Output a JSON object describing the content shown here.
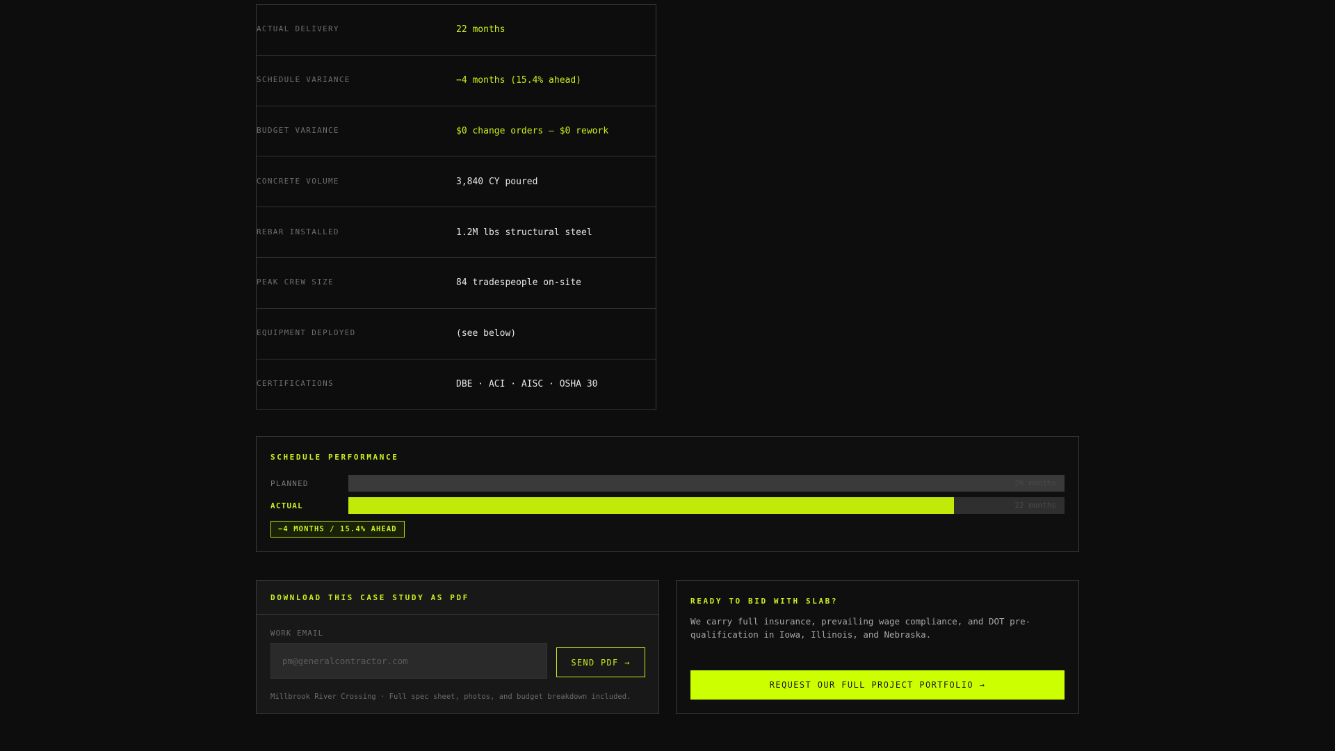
{
  "specs": [
    {
      "label": "ACTUAL DELIVERY",
      "value": "22 months",
      "accent": true
    },
    {
      "label": "SCHEDULE VARIANCE",
      "value": "−4 months (15.4% ahead)",
      "accent": true
    },
    {
      "label": "BUDGET VARIANCE",
      "value": "$0 change orders — $0 rework",
      "accent": true
    },
    {
      "label": "CONCRETE VOLUME",
      "value": "3,840 CY poured",
      "accent": false
    },
    {
      "label": "REBAR INSTALLED",
      "value": "1.2M lbs structural steel",
      "accent": false
    },
    {
      "label": "PEAK CREW SIZE",
      "value": "84 tradespeople on-site",
      "accent": false
    },
    {
      "label": "EQUIPMENT DEPLOYED",
      "value": "(see below)",
      "accent": false
    },
    {
      "label": "CERTIFICATIONS",
      "value": "DBE · ACI · AISC · OSHA 30",
      "accent": false
    }
  ],
  "schedule": {
    "title": "SCHEDULE PERFORMANCE",
    "planned_label": "PLANNED",
    "planned_value": "26 months",
    "planned_fraction": 1.0,
    "actual_label": "ACTUAL",
    "actual_value": "22 months",
    "actual_fraction": 0.846,
    "badge": "−4 MONTHS / 15.4% AHEAD"
  },
  "download": {
    "title": "DOWNLOAD THIS CASE STUDY AS PDF",
    "field_label": "WORK EMAIL",
    "email_value": "",
    "email_placeholder": "pm@generalcontractor.com",
    "send_label": "SEND PDF →",
    "note": "Millbrook River Crossing · Full spec sheet, photos, and budget breakdown included."
  },
  "bid": {
    "title": "READY TO BID WITH SLAB?",
    "text": "We carry full insurance, prevailing wage compliance, and DOT pre-qualification in Iowa, Illinois, and Nebraska.",
    "cta": "REQUEST OUR FULL PROJECT PORTFOLIO →"
  },
  "colors": {
    "accent": "#c8f01e",
    "background": "#0d0d0d",
    "panel": "#181818",
    "border": "#3a3a3a"
  }
}
